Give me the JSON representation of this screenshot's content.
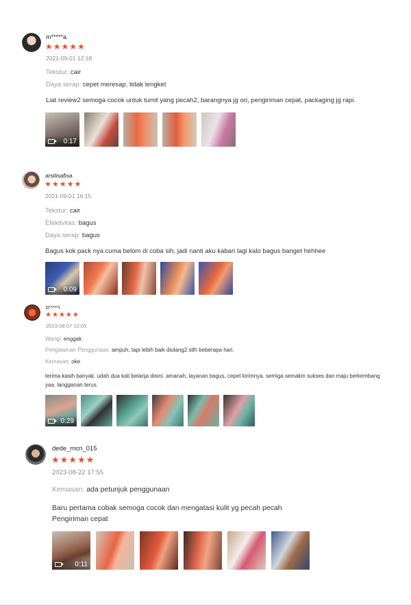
{
  "reviews": [
    {
      "username": "m*****a",
      "stars": "★★★★★",
      "date": "2021-09-01 12:18",
      "attributes": [
        {
          "key": "Tekstur:",
          "value": "cair"
        },
        {
          "key": "Daya serap:",
          "value": "cepet meresap, tidak lengket"
        }
      ],
      "comment": "Liat review2 semoga cocok untuk tumit yang pecah2, barangnya jg ori, pengiriman cepat, packaging jg rapi.",
      "video_duration": "0:17"
    },
    {
      "username": "arsilisafisa",
      "stars": "★★★★★",
      "date": "2021-09-01 16:15",
      "attributes": [
        {
          "key": "Tekstur:",
          "value": "cair"
        },
        {
          "key": "Efektivitas:",
          "value": "bagus"
        },
        {
          "key": "Daya serap:",
          "value": "bagus"
        }
      ],
      "comment": "Bagus kok pack nya cuma belom di coba sih, jadi nanti aku kabari lagi kalo bagus banget hehhee",
      "video_duration": "0:09"
    },
    {
      "username": "b*****i",
      "stars": "★★★★★",
      "date": "2023-08-07 12:05",
      "attributes": [
        {
          "key": "Wangi:",
          "value": "enggak"
        },
        {
          "key": "Pengalaman Penggunaan:",
          "value": "ampuh, tapi lebih baik diulang2 stlh beberapa hari."
        },
        {
          "key": "Kemasan:",
          "value": "oke"
        }
      ],
      "comment": "terima kasih banyak. udah dua kali belanja disini. amanah, layanan bagus, cepet kirimnya. semiga semakin sukses dan maju berkembang yaa. langganan terus.",
      "video_duration": "0:29"
    },
    {
      "username": "dede_mcn_015",
      "stars": "★★★★★",
      "date": "2023-08-22 17:55",
      "attributes": [
        {
          "key": "Kemasan:",
          "value": "ada petunjuk penggunaan"
        }
      ],
      "comment_lines": [
        "Baru pertama cobak semoga cocok dan mengatasi kulit yg pecah pecah",
        "Pengiriman cepat"
      ],
      "video_duration": "0:11"
    }
  ],
  "colors": {
    "star": "#ee4d2d",
    "key_text": "#9a9a9a",
    "date_text": "#888888"
  },
  "icons": {
    "video": "video-camera-icon"
  }
}
